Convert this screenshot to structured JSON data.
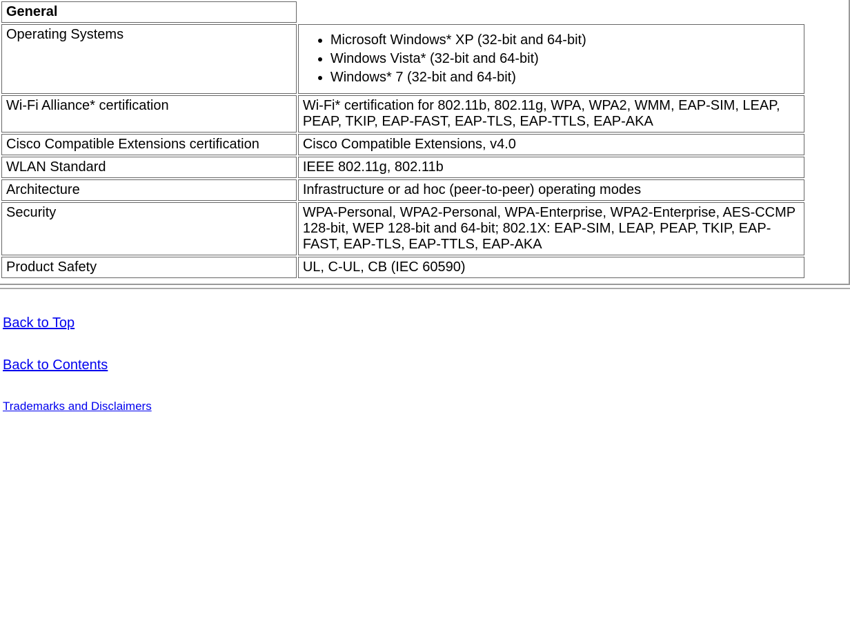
{
  "table": {
    "header": "General",
    "rows": [
      {
        "label": "Operating Systems",
        "list": [
          "Microsoft Windows* XP (32-bit and 64-bit)",
          "Windows Vista* (32-bit and 64-bit)",
          "Windows* 7 (32-bit and 64-bit)"
        ]
      },
      {
        "label": "Wi-Fi Alliance* certification",
        "value": "Wi-Fi* certification for 802.11b, 802.11g, WPA, WPA2, WMM, EAP-SIM, LEAP, PEAP, TKIP, EAP-FAST, EAP-TLS, EAP-TTLS, EAP-AKA"
      },
      {
        "label": "Cisco Compatible Extensions certification",
        "value": "Cisco Compatible Extensions, v4.0"
      },
      {
        "label": "WLAN Standard",
        "value": "IEEE 802.11g, 802.11b"
      },
      {
        "label": "Architecture",
        "value": "Infrastructure or ad hoc (peer-to-peer) operating modes"
      },
      {
        "label": "Security",
        "value": "WPA-Personal, WPA2-Personal, WPA-Enterprise, WPA2-Enterprise, AES-CCMP 128-bit, WEP 128-bit and 64-bit; 802.1X: EAP-SIM, LEAP, PEAP, TKIP, EAP-FAST, EAP-TLS, EAP-TTLS, EAP-AKA"
      },
      {
        "label": "Product Safety",
        "value": "UL, C-UL, CB (IEC 60590)"
      }
    ]
  },
  "links": {
    "back_top": "Back to Top",
    "back_contents": "Back to Contents",
    "trademarks": "Trademarks and Disclaimers"
  }
}
